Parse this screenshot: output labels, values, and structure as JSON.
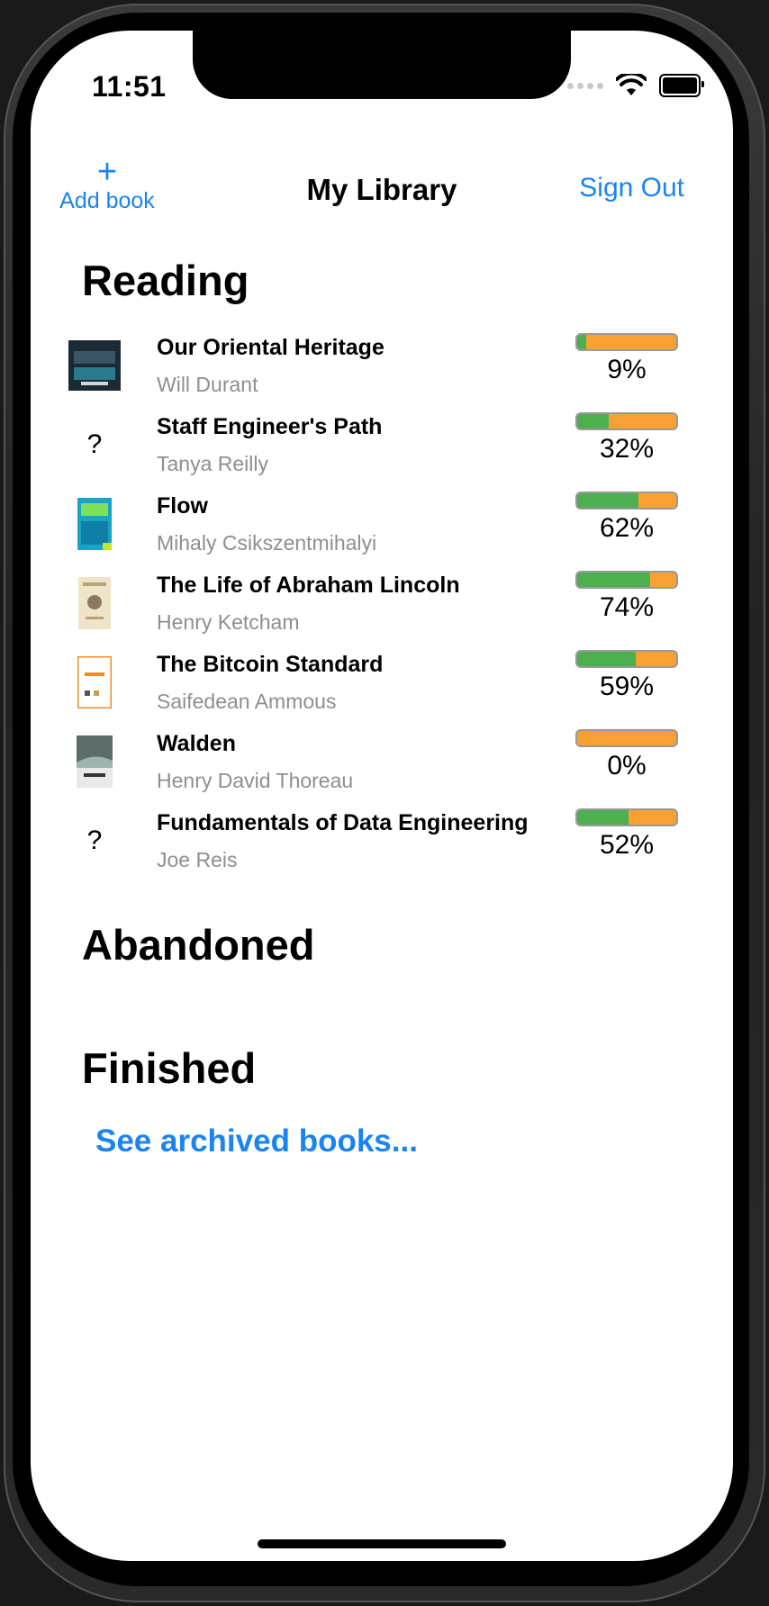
{
  "status_bar": {
    "time": "11:51"
  },
  "nav": {
    "add_label": "Add book",
    "add_symbol": "+",
    "title": "My Library",
    "sign_out": "Sign Out"
  },
  "sections": {
    "reading": "Reading",
    "abandoned": "Abandoned",
    "finished": "Finished"
  },
  "books": [
    {
      "title": "Our Oriental Heritage",
      "author": "Will Durant",
      "percent_label": "9%",
      "progress": 0.09,
      "cover": "cover-image"
    },
    {
      "title": "Staff Engineer's Path",
      "author": "Tanya Reilly",
      "percent_label": "32%",
      "progress": 0.32,
      "cover": "?"
    },
    {
      "title": "Flow",
      "author": "Mihaly Csikszentmihalyi",
      "percent_label": "62%",
      "progress": 0.62,
      "cover": "cover-image"
    },
    {
      "title": "The Life of Abraham Lincoln",
      "author": "Henry Ketcham",
      "percent_label": "74%",
      "progress": 0.74,
      "cover": "cover-image"
    },
    {
      "title": "The Bitcoin Standard",
      "author": "Saifedean Ammous",
      "percent_label": "59%",
      "progress": 0.59,
      "cover": "cover-image"
    },
    {
      "title": "Walden",
      "author": "Henry David Thoreau",
      "percent_label": "0%",
      "progress": 0.0,
      "cover": "cover-image"
    },
    {
      "title": "Fundamentals of Data Engineering",
      "author": "Joe Reis",
      "percent_label": "52%",
      "progress": 0.52,
      "cover": "?"
    }
  ],
  "archive_link": "See archived books...",
  "colors": {
    "accent": "#1a84f0",
    "progress_done": "#4caf50",
    "progress_remaining": "#f8a032"
  },
  "icons": {
    "add": "plus-icon",
    "wifi": "wifi-icon",
    "battery": "battery-icon",
    "signal": "cellular-signal-icon"
  }
}
